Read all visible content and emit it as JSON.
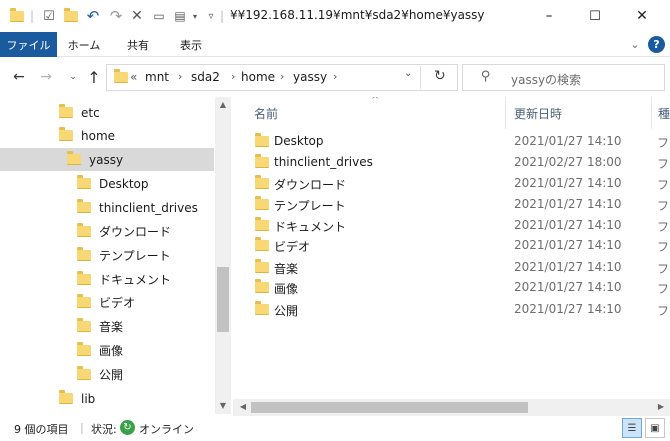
{
  "titlebar": {
    "title": "¥¥192.168.11.19¥mnt¥sda2¥home¥yassy",
    "minimize_icon": "–",
    "maximize_icon": "☐",
    "close_icon": "✕"
  },
  "ribbon": {
    "tabs": [
      {
        "label": "ファイル"
      },
      {
        "label": "ホーム"
      },
      {
        "label": "共有"
      },
      {
        "label": "表示"
      }
    ]
  },
  "nav": {
    "breadcrumbs": [
      "mnt",
      "sda2",
      "home",
      "yassy"
    ],
    "overflow": "«",
    "search_placeholder": "yassyの検索"
  },
  "tree": [
    {
      "label": "etc",
      "selected": false
    },
    {
      "label": "home",
      "selected": false
    },
    {
      "label": "yassy",
      "selected": true
    },
    {
      "label": "Desktop",
      "selected": false
    },
    {
      "label": "thinclient_drives",
      "selected": false
    },
    {
      "label": "ダウンロード",
      "selected": false
    },
    {
      "label": "テンプレート",
      "selected": false
    },
    {
      "label": "ドキュメント",
      "selected": false
    },
    {
      "label": "ビデオ",
      "selected": false
    },
    {
      "label": "音楽",
      "selected": false
    },
    {
      "label": "画像",
      "selected": false
    },
    {
      "label": "公開",
      "selected": false
    },
    {
      "label": "lib",
      "selected": false
    }
  ],
  "columns": {
    "name": "名前",
    "date": "更新日時",
    "type": "種"
  },
  "files": [
    {
      "name": "Desktop",
      "date": "2021/01/27 14:10",
      "type": "フ"
    },
    {
      "name": "thinclient_drives",
      "date": "2021/02/27 18:00",
      "type": "フ"
    },
    {
      "name": "ダウンロード",
      "date": "2021/01/27 14:10",
      "type": "フ"
    },
    {
      "name": "テンプレート",
      "date": "2021/01/27 14:10",
      "type": "フ"
    },
    {
      "name": "ドキュメント",
      "date": "2021/01/27 14:10",
      "type": "フ"
    },
    {
      "name": "ビデオ",
      "date": "2021/01/27 14:10",
      "type": "フ"
    },
    {
      "name": "音楽",
      "date": "2021/01/27 14:10",
      "type": "フ"
    },
    {
      "name": "画像",
      "date": "2021/01/27 14:10",
      "type": "フ"
    },
    {
      "name": "公開",
      "date": "2021/01/27 14:10",
      "type": "フ"
    }
  ],
  "status": {
    "count": "9 個の項目",
    "state_label": "状況:",
    "state_value": "オンライン"
  },
  "colors": {
    "file_tab": "#1a5ba0",
    "folder": "#f8d775",
    "selection": "#d9d9d9",
    "online": "#3aa14a"
  }
}
